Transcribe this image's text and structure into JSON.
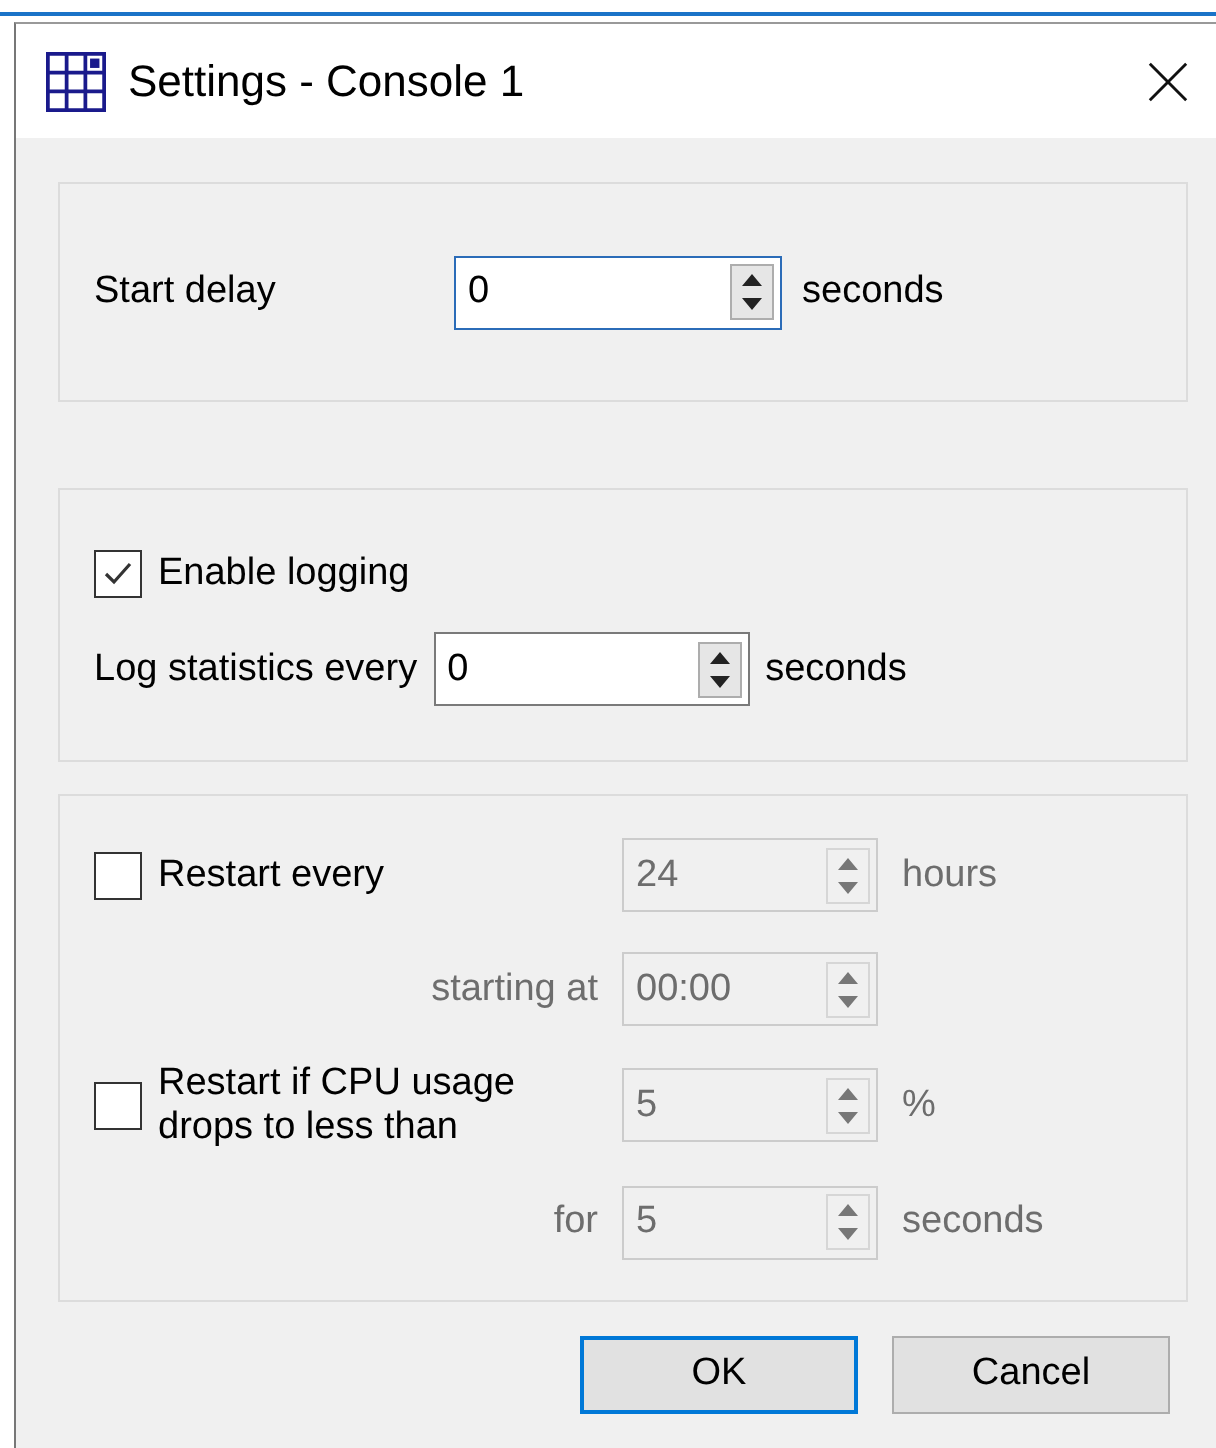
{
  "window": {
    "title": "Settings - Console 1"
  },
  "start_delay": {
    "label": "Start delay",
    "value": "0",
    "focused": true,
    "disabled": false,
    "unit": "seconds"
  },
  "logging": {
    "checkbox": {
      "label": "Enable logging",
      "checked": true
    },
    "interval": {
      "label": "Log statistics every",
      "value": "0",
      "focused": false,
      "disabled": false,
      "unit": "seconds"
    }
  },
  "restart": {
    "periodic": {
      "checkbox": {
        "label": "Restart every",
        "checked": false
      },
      "interval": {
        "value": "24",
        "disabled": true,
        "unit": "hours"
      },
      "start_time": {
        "label": "starting at",
        "value": "00:00",
        "disabled": true
      }
    },
    "cpu": {
      "checkbox": {
        "label": "Restart if CPU usage drops to less than",
        "checked": false
      },
      "threshold": {
        "value": "5",
        "disabled": true,
        "unit": "%"
      },
      "duration": {
        "label": "for",
        "value": "5",
        "disabled": true,
        "unit": "seconds"
      }
    }
  },
  "buttons": [
    {
      "label": "OK",
      "default": true
    },
    {
      "label": "Cancel",
      "default": false
    }
  ]
}
